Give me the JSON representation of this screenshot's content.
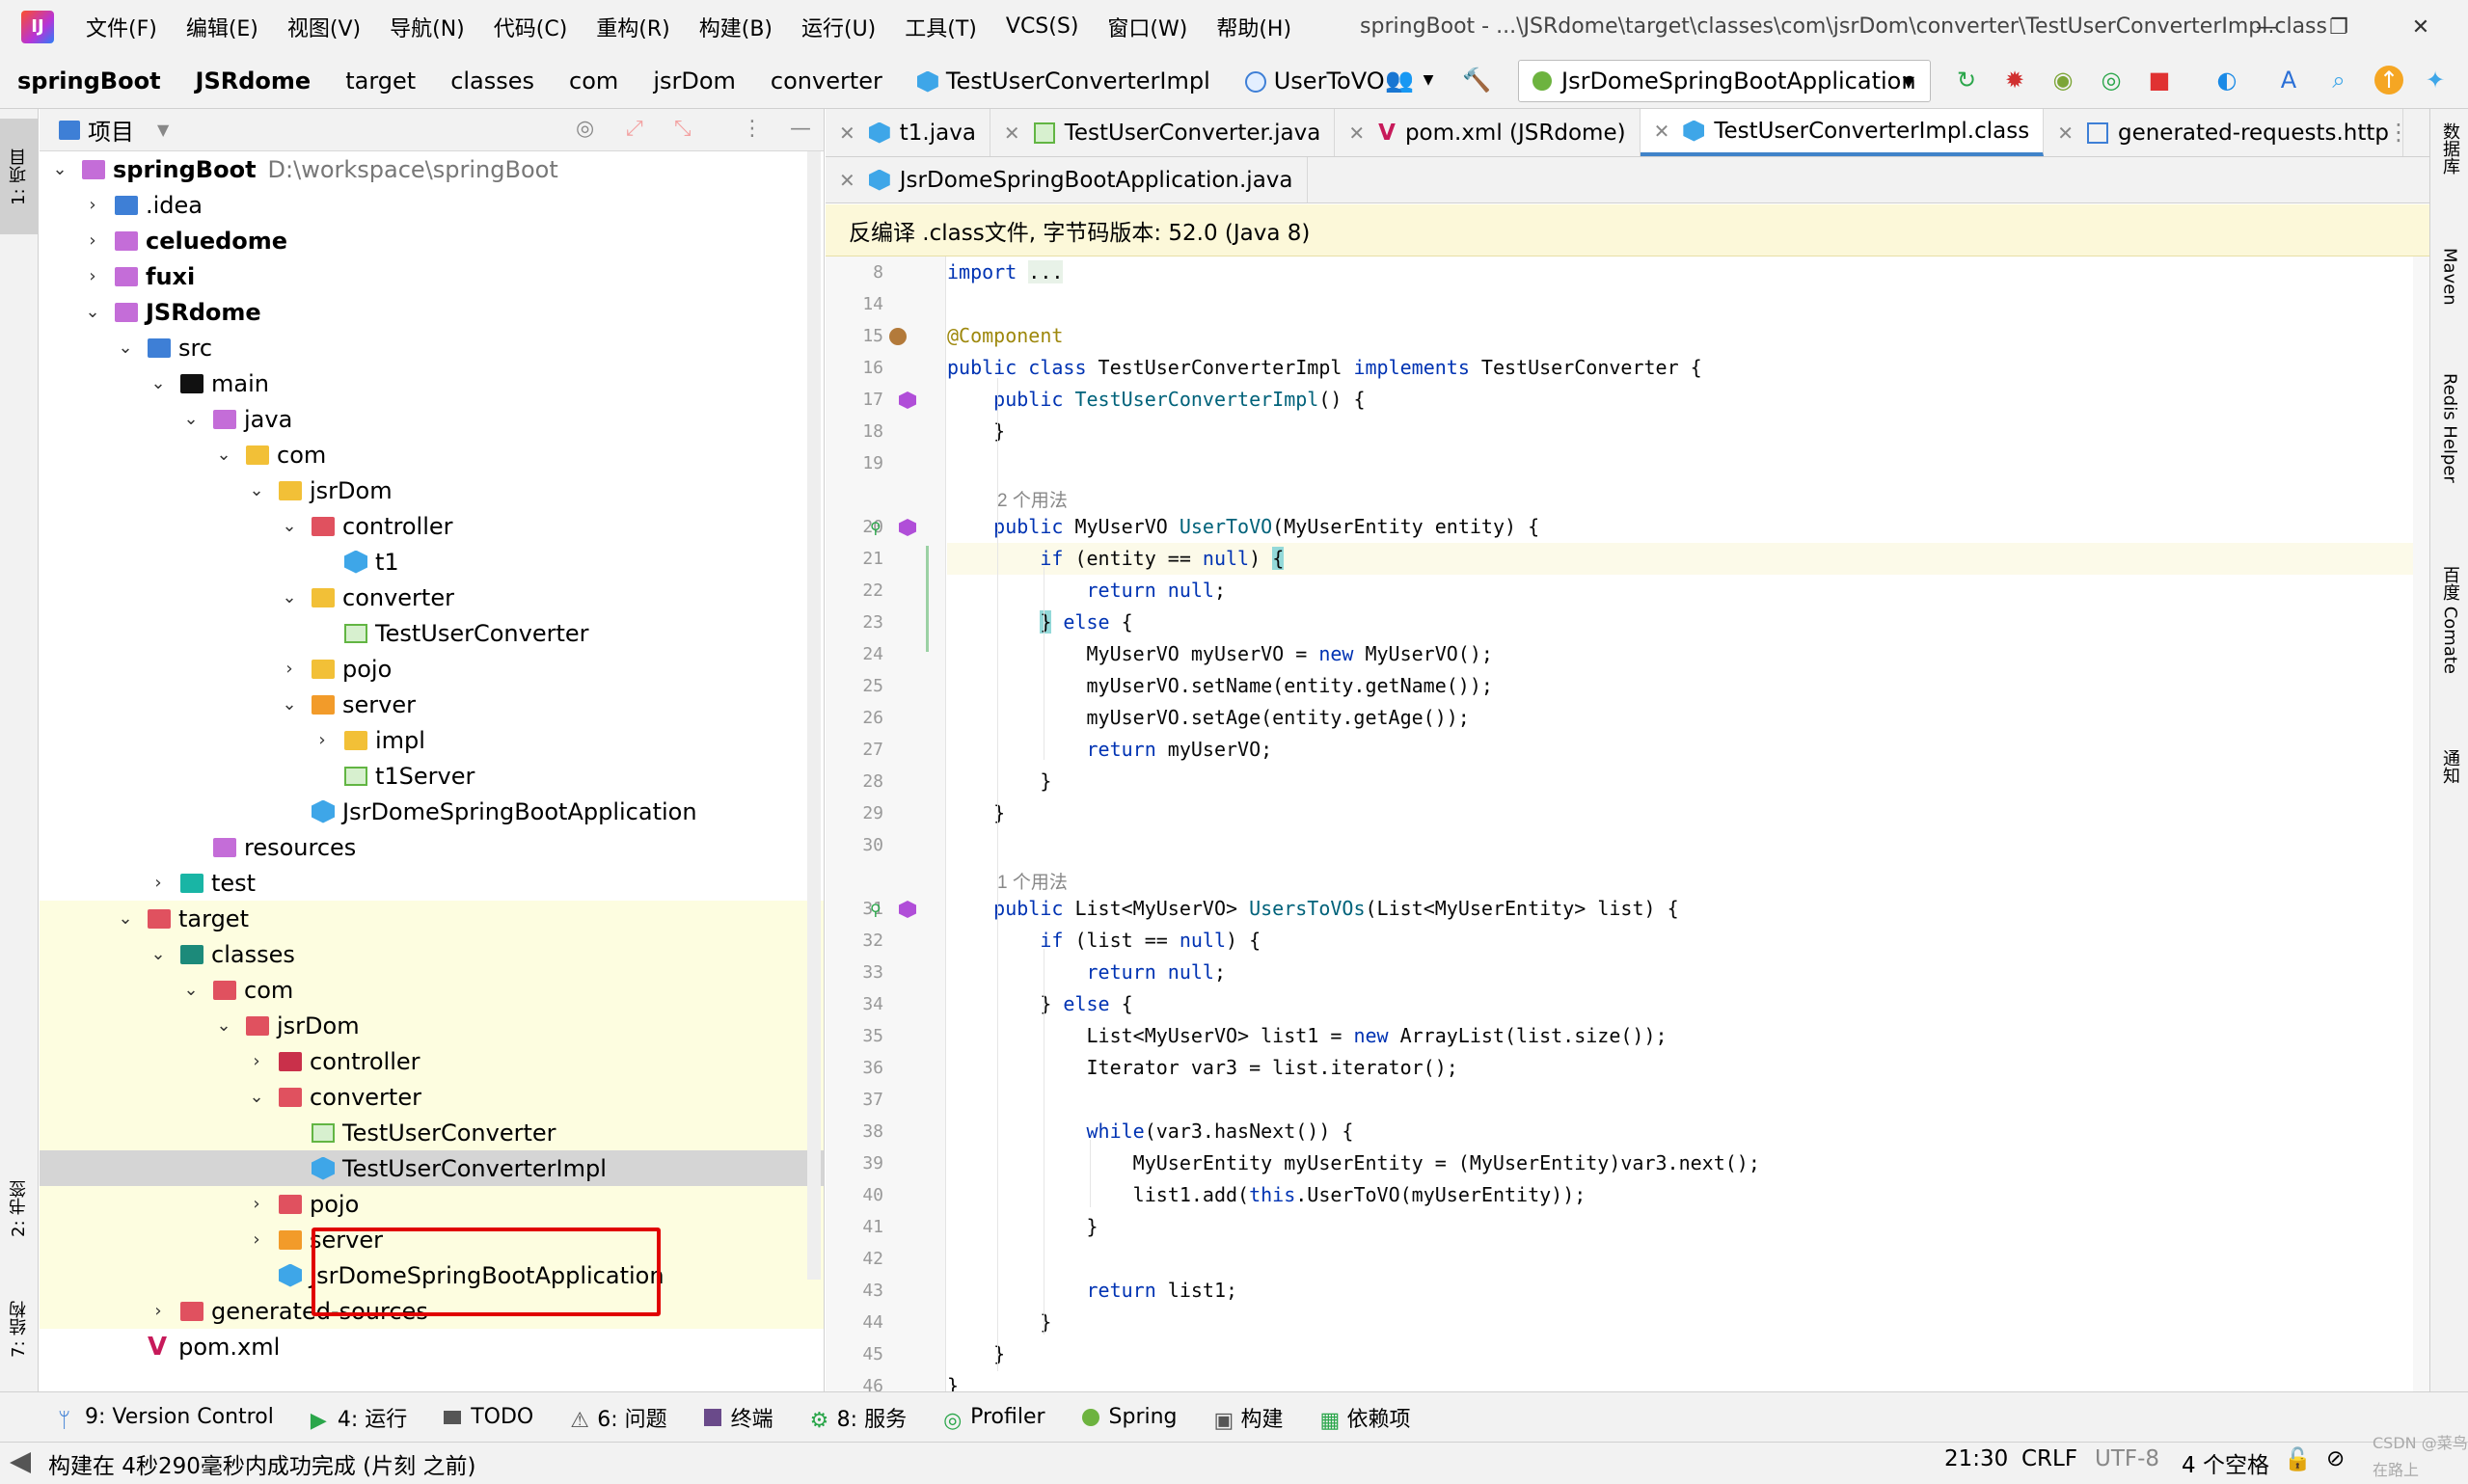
{
  "menubar": {
    "items": [
      "文件(F)",
      "编辑(E)",
      "视图(V)",
      "导航(N)",
      "代码(C)",
      "重构(R)",
      "构建(B)",
      "运行(U)",
      "工具(T)",
      "VCS(S)",
      "窗口(W)",
      "帮助(H)"
    ],
    "title": "springBoot - ...\\JSRdome\\target\\classes\\com\\jsrDom\\converter\\TestUserConverterImpl.class"
  },
  "navbar": {
    "crumbs": [
      "springBoot",
      "JSRdome",
      "target",
      "classes",
      "com",
      "jsrDom",
      "converter",
      "TestUserConverterImpl",
      "UserToVO"
    ],
    "run_config": "JsrDomeSpringBootApplication"
  },
  "left_strip": {
    "tabs": [
      "1: 项目",
      "2: 书签",
      "7: 结构"
    ]
  },
  "right_strip": {
    "tabs": [
      "数据库",
      "Maven",
      "Redis Helper",
      "百度 Comate",
      "通知"
    ]
  },
  "project": {
    "title": "项目",
    "rows": [
      {
        "label": "springBoot",
        "extra": "D:\\workspace\\springBoot"
      },
      {
        "label": ".idea"
      },
      {
        "label": "celuedome"
      },
      {
        "label": "fuxi"
      },
      {
        "label": "JSRdome"
      },
      {
        "label": "src"
      },
      {
        "label": "main"
      },
      {
        "label": "java"
      },
      {
        "label": "com"
      },
      {
        "label": "jsrDom"
      },
      {
        "label": "controller"
      },
      {
        "label": "t1"
      },
      {
        "label": "converter"
      },
      {
        "label": "TestUserConverter"
      },
      {
        "label": "pojo"
      },
      {
        "label": "server"
      },
      {
        "label": "impl"
      },
      {
        "label": "t1Server"
      },
      {
        "label": "JsrDomeSpringBootApplication"
      },
      {
        "label": "resources"
      },
      {
        "label": "test"
      },
      {
        "label": "target"
      },
      {
        "label": "classes"
      },
      {
        "label": "com"
      },
      {
        "label": "jsrDom"
      },
      {
        "label": "controller"
      },
      {
        "label": "converter"
      },
      {
        "label": "TestUserConverter"
      },
      {
        "label": "TestUserConverterImpl"
      },
      {
        "label": "pojo"
      },
      {
        "label": "server"
      },
      {
        "label": "JsrDomeSpringBootApplication"
      },
      {
        "label": "generated-sources"
      },
      {
        "label": "pom.xml"
      }
    ]
  },
  "tabs_row1": [
    "t1.java",
    "TestUserConverter.java",
    "pom.xml (JSRdome)",
    "TestUserConverterImpl.class",
    "generated-requests.http"
  ],
  "tabs_row2": [
    "JsrDomeSpringBootApplication.java"
  ],
  "banner": "反编译 .class文件, 字节码版本: 52.0 (Java 8)",
  "code": {
    "line_numbers": [
      "8",
      "14",
      "15",
      "16",
      "17",
      "18",
      "19",
      "20",
      "21",
      "22",
      "23",
      "24",
      "25",
      "26",
      "27",
      "28",
      "29",
      "30",
      "31",
      "32",
      "33",
      "34",
      "35",
      "36",
      "37",
      "38",
      "39",
      "40",
      "41",
      "42",
      "43",
      "44",
      "45",
      "46"
    ],
    "usages1": "2 个用法",
    "usages2": "1 个用法"
  },
  "bottom_tools": [
    "9: Version Control",
    "4: 运行",
    "TODO",
    "6: 问题",
    "终端",
    "8: 服务",
    "Profiler",
    "Spring",
    "构建",
    "依赖项"
  ],
  "status": {
    "message": "构建在 4秒290毫秒内成功完成 (片刻 之前)",
    "position": "21:30",
    "line_sep": "CRLF",
    "encoding": "UTF-8",
    "indent": "4 个空格",
    "watermark": "CSDN @菜鸟在路上"
  }
}
